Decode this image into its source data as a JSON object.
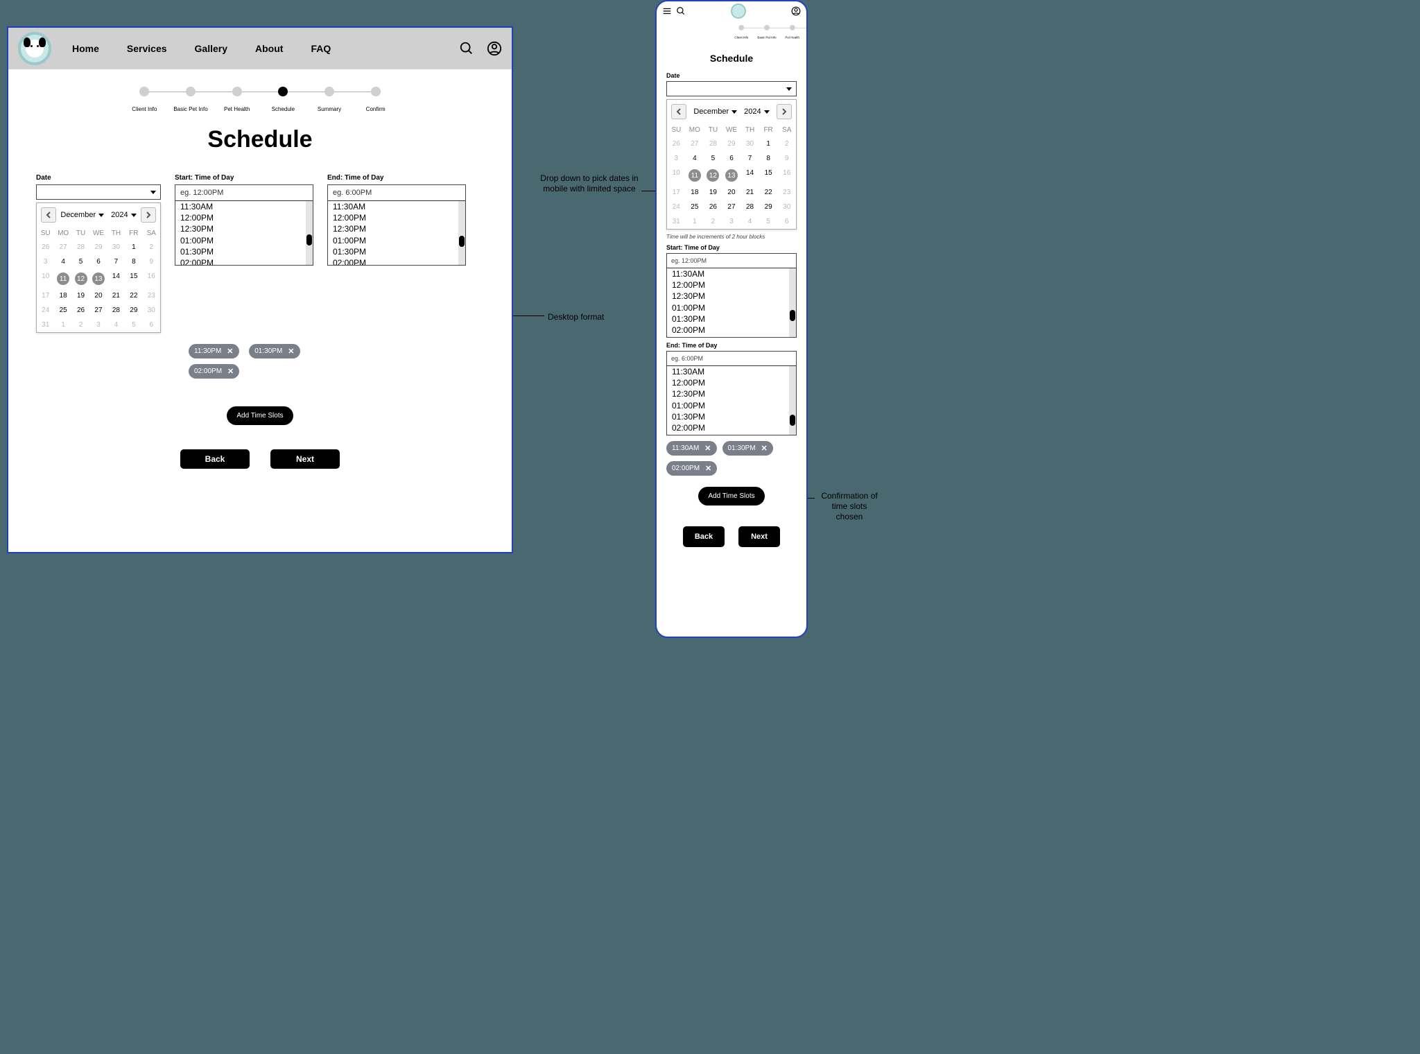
{
  "annotations": {
    "dropdown": "Drop down to pick dates in mobile with limited space",
    "desktop_format": "Desktop format",
    "confirm_slots": "Confirmation of time slots chosen"
  },
  "nav": {
    "items": [
      "Home",
      "Services",
      "Gallery",
      "About",
      "FAQ"
    ]
  },
  "stepper": {
    "steps": [
      "Client Info",
      "Basic Pet Info",
      "Pet Health",
      "Schedule",
      "Summary",
      "Confirm"
    ],
    "active_index": 3
  },
  "page_title": "Schedule",
  "labels": {
    "date": "Date",
    "start": "Start: Time of Day",
    "end": "End: Time of Day",
    "add_slots": "Add Time Slots",
    "back": "Back",
    "next": "Next",
    "increments_note": "Time will be increments of 2 hour blocks"
  },
  "placeholders": {
    "start": "eg. 12:00PM",
    "end": "eg. 6:00PM"
  },
  "time_options": [
    "11:30AM",
    "12:00PM",
    "12:30PM",
    "01:00PM",
    "01:30PM",
    "02:00PM"
  ],
  "desktop_chips": {
    "start": [
      "11:30PM",
      "02:00PM"
    ],
    "end": [
      "01:30PM"
    ]
  },
  "mobile_chips": [
    "11:30AM",
    "01:30PM",
    "02:00PM"
  ],
  "calendar": {
    "month": "December",
    "year": "2024",
    "weekdays": [
      "SU",
      "MO",
      "TU",
      "WE",
      "TH",
      "FR",
      "SA"
    ],
    "rows": [
      [
        {
          "d": "26",
          "mu": true
        },
        {
          "d": "27",
          "mu": true
        },
        {
          "d": "28",
          "mu": true
        },
        {
          "d": "29",
          "mu": true
        },
        {
          "d": "30",
          "mu": true
        },
        {
          "d": "1"
        },
        {
          "d": "2",
          "mu": true
        }
      ],
      [
        {
          "d": "3",
          "mu": true
        },
        {
          "d": "4"
        },
        {
          "d": "5"
        },
        {
          "d": "6"
        },
        {
          "d": "7"
        },
        {
          "d": "8"
        },
        {
          "d": "9",
          "mu": true
        }
      ],
      [
        {
          "d": "10",
          "mu": true
        },
        {
          "d": "11",
          "sel": true
        },
        {
          "d": "12",
          "sel": true
        },
        {
          "d": "13",
          "sel": true
        },
        {
          "d": "14"
        },
        {
          "d": "15"
        },
        {
          "d": "16",
          "mu": true
        }
      ],
      [
        {
          "d": "17",
          "mu": true
        },
        {
          "d": "18"
        },
        {
          "d": "19"
        },
        {
          "d": "20"
        },
        {
          "d": "21"
        },
        {
          "d": "22"
        },
        {
          "d": "23",
          "mu": true
        }
      ],
      [
        {
          "d": "24",
          "mu": true
        },
        {
          "d": "25"
        },
        {
          "d": "26"
        },
        {
          "d": "27"
        },
        {
          "d": "28"
        },
        {
          "d": "29"
        },
        {
          "d": "30",
          "mu": true
        }
      ],
      [
        {
          "d": "31",
          "mu": true
        },
        {
          "d": "1",
          "mu": true
        },
        {
          "d": "2",
          "mu": true
        },
        {
          "d": "3",
          "mu": true
        },
        {
          "d": "4",
          "mu": true
        },
        {
          "d": "5",
          "mu": true
        },
        {
          "d": "6",
          "mu": true
        }
      ]
    ]
  }
}
